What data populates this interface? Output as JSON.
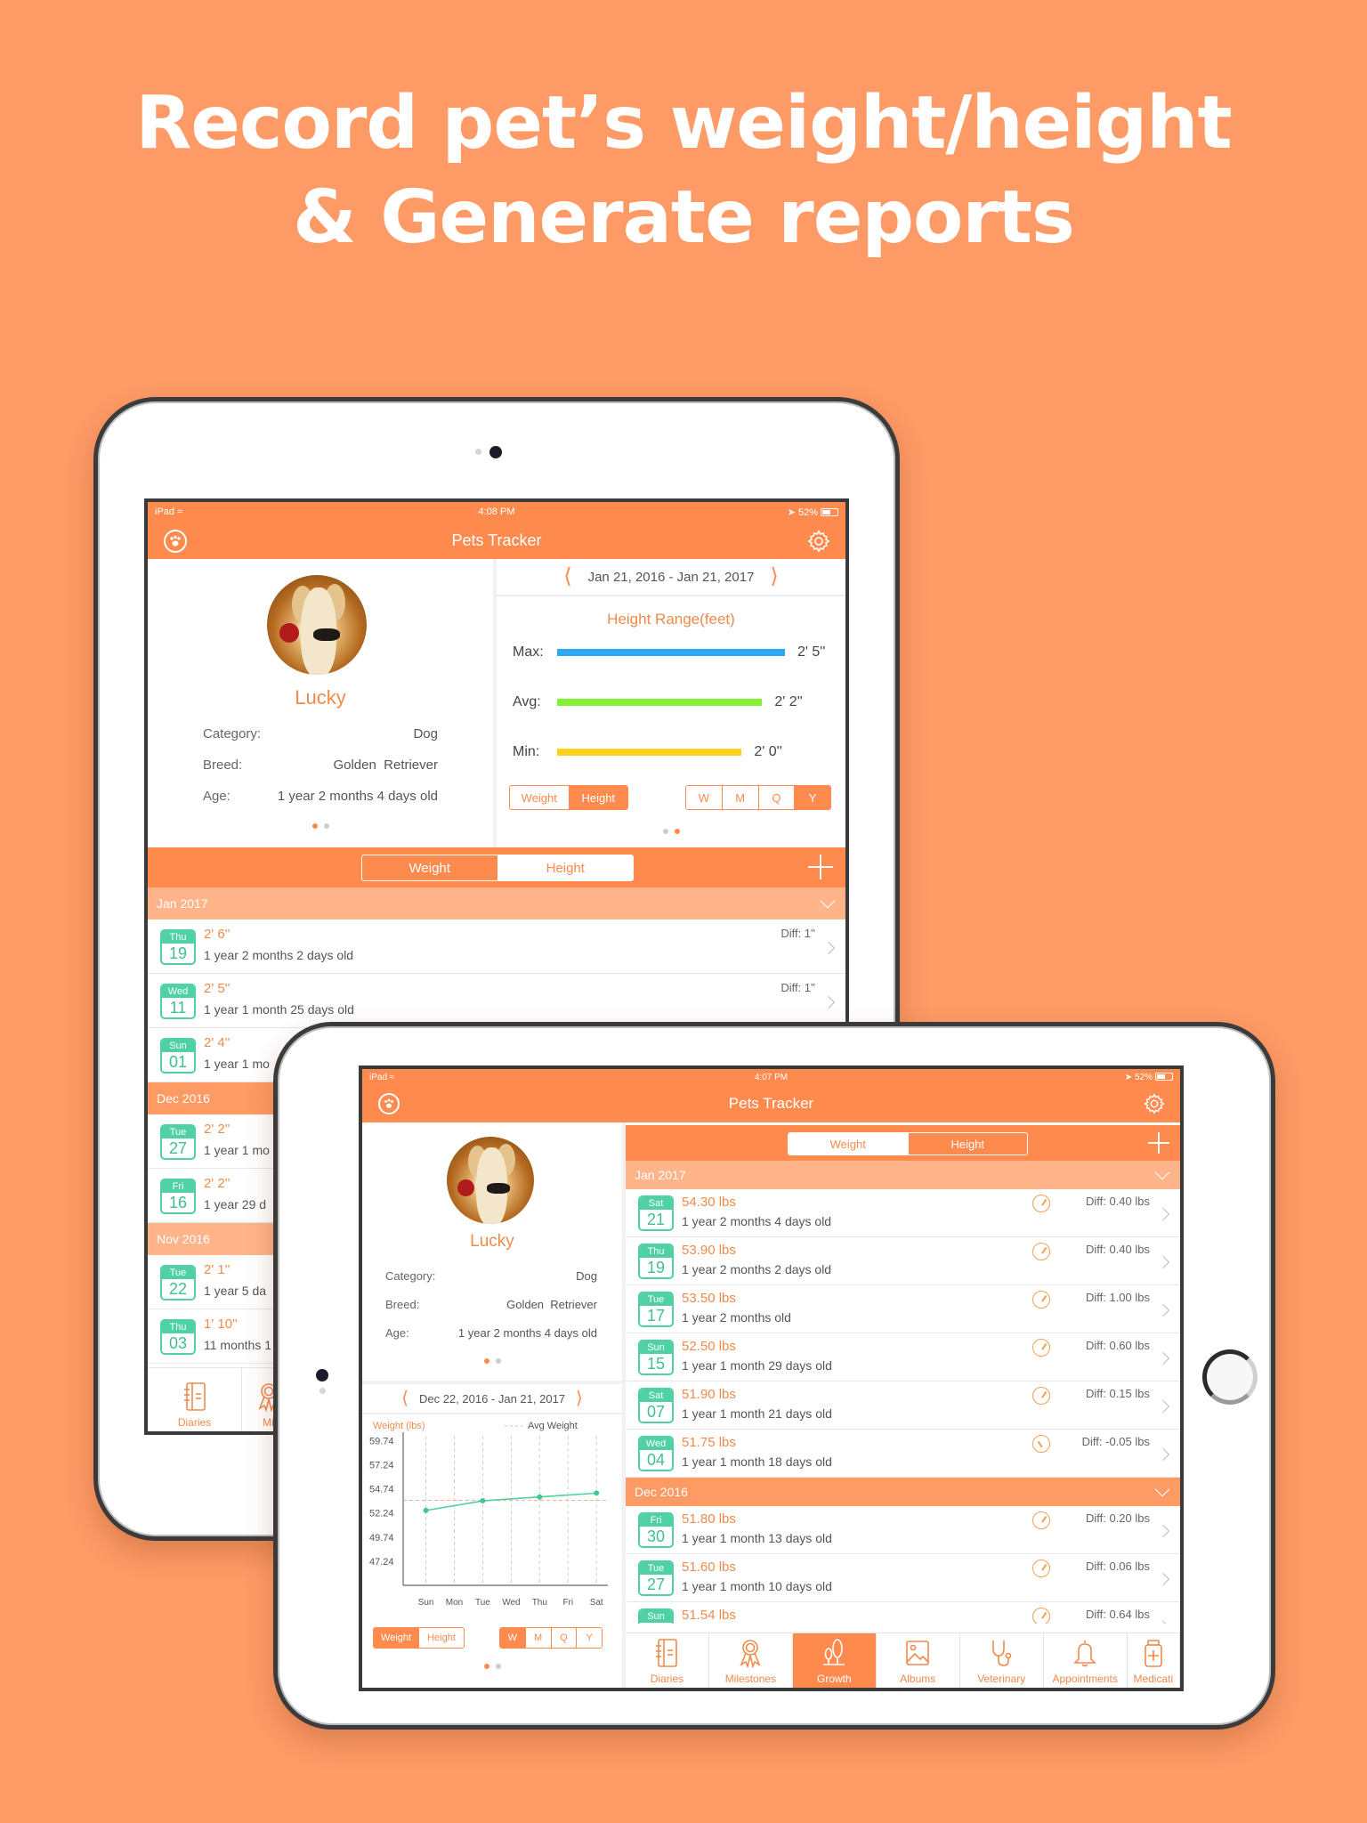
{
  "headline": {
    "line1": "Record pet’s weight/height",
    "line2": "& Generate reports"
  },
  "colors": {
    "background": "#fe9a66",
    "accent": "#fe8a4e",
    "section_light": "#ffb48a",
    "calendar_green": "#4fd1a3",
    "bar_max": "#2fa8f2",
    "bar_avg": "#84f232",
    "bar_min": "#fdd21f"
  },
  "portrait": {
    "status": {
      "carrier": "iPad",
      "time": "4:08 PM",
      "battery": "52%"
    },
    "nav": {
      "title": "Pets Tracker",
      "left_icon": "paw-icon",
      "right_icon": "gear-icon"
    },
    "profile": {
      "name": "Lucky",
      "fields": [
        {
          "label": "Category:",
          "value": "Dog"
        },
        {
          "label": "Breed:",
          "value": "Golden  Retriever"
        },
        {
          "label": "Age:",
          "value": "1 year 2 months 4 days old"
        }
      ]
    },
    "range": {
      "text": "Jan 21, 2016 - Jan 21, 2017"
    },
    "height_range": {
      "title": "Height Range(feet)",
      "rows": [
        {
          "label": "Max:",
          "value": "2' 5''",
          "fraction": 1.0
        },
        {
          "label": "Avg:",
          "value": "2' 2''",
          "fraction": 0.9
        },
        {
          "label": "Min:",
          "value": "2' 0''",
          "fraction": 0.81
        }
      ],
      "metric_options": [
        "Weight",
        "Height"
      ],
      "metric_selected": "Height",
      "period_options": [
        "W",
        "M",
        "Q",
        "Y"
      ],
      "period_selected": "Y"
    },
    "segment": {
      "options": [
        "Weight",
        "Height"
      ],
      "selected": "Height"
    },
    "sections": [
      {
        "title": "Jan 2017",
        "collapsible": true,
        "rows": [
          {
            "day": "Thu",
            "date": "19",
            "value": "2' 6''",
            "age": "1 year 2 months 2 days old",
            "diff": "Diff: 1''"
          },
          {
            "day": "Wed",
            "date": "11",
            "value": "2' 5''",
            "age": "1 year 1 month 25 days old",
            "diff": "Diff: 1''"
          },
          {
            "day": "Sun",
            "date": "01",
            "value": "2' 4''",
            "age": "1 year 1 mo",
            "diff": ""
          }
        ]
      },
      {
        "title": "Dec 2016",
        "rows": [
          {
            "day": "Tue",
            "date": "27",
            "value": "2' 2''",
            "age": "1 year 1 mo",
            "diff": ""
          },
          {
            "day": "Fri",
            "date": "16",
            "value": "2' 2''",
            "age": "1 year 29 d",
            "diff": ""
          }
        ]
      },
      {
        "title": "Nov 2016",
        "rows": [
          {
            "day": "Tue",
            "date": "22",
            "value": "2' 1''",
            "age": "1 year 5 da",
            "diff": ""
          },
          {
            "day": "Thu",
            "date": "03",
            "value": "1' 10''",
            "age": "11 months 1",
            "diff": ""
          }
        ]
      }
    ],
    "tabs": [
      {
        "label": "Diaries",
        "icon": "diary-icon"
      },
      {
        "label": "Mi",
        "icon": "milestone-icon"
      }
    ]
  },
  "landscape": {
    "status": {
      "carrier": "iPad",
      "time": "4:07 PM",
      "battery": "52%"
    },
    "nav": {
      "title": "Pets Tracker",
      "left_icon": "paw-icon",
      "right_icon": "gear-icon"
    },
    "profile": {
      "name": "Lucky",
      "fields": [
        {
          "label": "Category:",
          "value": "Dog"
        },
        {
          "label": "Breed:",
          "value": "Golden  Retriever"
        },
        {
          "label": "Age:",
          "value": "1 year 2 months 4 days old"
        }
      ]
    },
    "range": {
      "text": "Dec 22, 2016 - Jan 21, 2017"
    },
    "chart_controls": {
      "metric_options": [
        "Weight",
        "Height"
      ],
      "metric_selected": "Weight",
      "period_options": [
        "W",
        "M",
        "Q",
        "Y"
      ],
      "period_selected": "W"
    },
    "segment": {
      "options": [
        "Weight",
        "Height"
      ],
      "selected": "Weight"
    },
    "sections": [
      {
        "title": "Jan 2017",
        "rows": [
          {
            "day": "Sat",
            "date": "21",
            "value": "54.30 lbs",
            "age": "1 year 2 months 4 days old",
            "diff": "Diff: 0.40 lbs",
            "trend": "up"
          },
          {
            "day": "Thu",
            "date": "19",
            "value": "53.90 lbs",
            "age": "1 year 2 months 2 days old",
            "diff": "Diff: 0.40 lbs",
            "trend": "up"
          },
          {
            "day": "Tue",
            "date": "17",
            "value": "53.50 lbs",
            "age": "1 year 2 months old",
            "diff": "Diff: 1.00 lbs",
            "trend": "up"
          },
          {
            "day": "Sun",
            "date": "15",
            "value": "52.50 lbs",
            "age": "1 year 1 month 29 days old",
            "diff": "Diff: 0.60 lbs",
            "trend": "up"
          },
          {
            "day": "Sat",
            "date": "07",
            "value": "51.90 lbs",
            "age": "1 year 1 month 21 days old",
            "diff": "Diff: 0.15 lbs",
            "trend": "up"
          },
          {
            "day": "Wed",
            "date": "04",
            "value": "51.75 lbs",
            "age": "1 year 1 month 18 days old",
            "diff": "Diff: -0.05 lbs",
            "trend": "down"
          }
        ]
      },
      {
        "title": "Dec 2016",
        "rows": [
          {
            "day": "Fri",
            "date": "30",
            "value": "51.80 lbs",
            "age": "1 year 1 month 13 days old",
            "diff": "Diff: 0.20 lbs",
            "trend": "up"
          },
          {
            "day": "Tue",
            "date": "27",
            "value": "51.60 lbs",
            "age": "1 year 1 month 10 days old",
            "diff": "Diff: 0.06 lbs",
            "trend": "up"
          },
          {
            "day": "Sun",
            "date": "",
            "value": "51.54 lbs",
            "age": "",
            "diff": "Diff: 0.64 lbs",
            "trend": "up"
          }
        ]
      }
    ],
    "tabs": [
      {
        "label": "Diaries",
        "icon": "diary-icon"
      },
      {
        "label": "Milestones",
        "icon": "milestone-icon"
      },
      {
        "label": "Growth",
        "icon": "growth-icon",
        "active": true
      },
      {
        "label": "Albums",
        "icon": "album-icon"
      },
      {
        "label": "Veterinary",
        "icon": "stethoscope-icon"
      },
      {
        "label": "Appointments",
        "icon": "bell-icon"
      },
      {
        "label": "Medicati",
        "icon": "medication-icon"
      }
    ]
  },
  "chart_data": {
    "type": "line",
    "title": "",
    "ylabel": "Weight (lbs)",
    "xlabel": "",
    "legend": "Avg Weight",
    "legend_position": "top-right",
    "categories": [
      "Sun",
      "Mon",
      "Tue",
      "Wed",
      "Thu",
      "Fri",
      "Sat"
    ],
    "y_ticks": [
      59.74,
      57.24,
      54.74,
      52.24,
      49.74,
      47.24
    ],
    "ylim": [
      44.74,
      60.24
    ],
    "grid": "vertical-dashed",
    "series": [
      {
        "name": "Weight",
        "points": [
          {
            "x": "Sun",
            "y": 52.5
          },
          {
            "x": "Tue",
            "y": 53.5
          },
          {
            "x": "Thu",
            "y": 53.9
          },
          {
            "x": "Sat",
            "y": 54.3
          }
        ]
      }
    ],
    "average": 53.55
  }
}
